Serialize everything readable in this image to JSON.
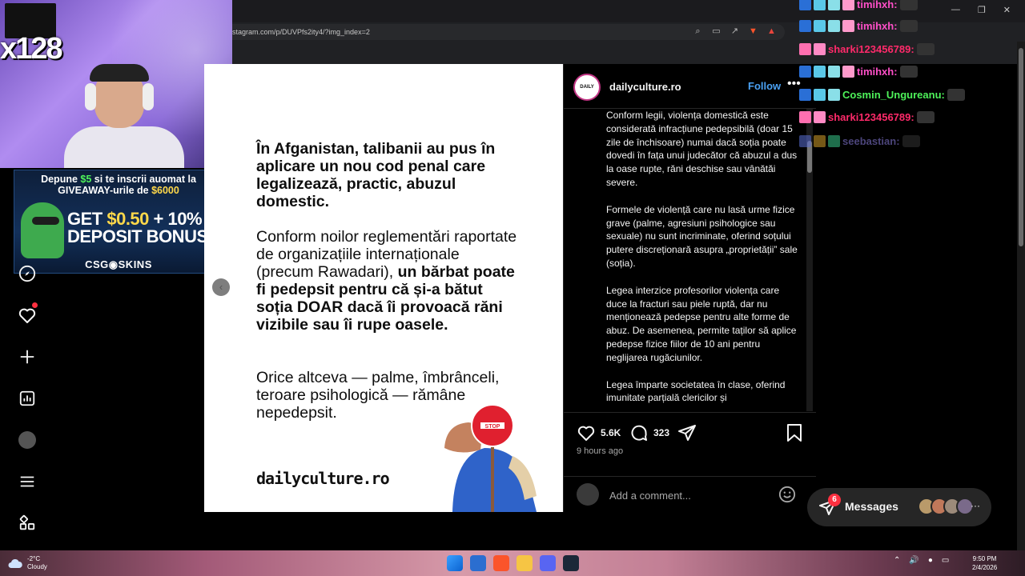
{
  "browser": {
    "url": "stagram.com/p/DUVPfs2ity4/?img_index=2"
  },
  "stream": {
    "sub_count": "x128",
    "ad": {
      "line1_a": "Depune ",
      "line1_amount": "$5",
      "line1_b": " si te inscrii auomat la",
      "line2_a": "GIVEAWAY-urile de ",
      "line2_amount": "$6000",
      "bonus_a": "GET ",
      "bonus_amount": "$0.50",
      "bonus_b": " + 10%",
      "bonus_line2": "DEPOSIT BONUS",
      "brand": "CSG◉SKINS"
    },
    "chat": [
      {
        "user": "timihxh:",
        "color": "#ff4fc8"
      },
      {
        "user": "timihxh:",
        "color": "#ff4fc8"
      },
      {
        "user": "sharki123456789:",
        "color": "#ff2a6a"
      },
      {
        "user": "timihxh:",
        "color": "#ff4fc8"
      },
      {
        "user": "Cosmin_Ungureanu:",
        "color": "#4ef25a"
      },
      {
        "user": "sharki123456789:",
        "color": "#ff2a6a"
      },
      {
        "user": "seebastian:",
        "color": "#8a7ee0"
      }
    ]
  },
  "post": {
    "text1": "În Afganistan, talibanii au pus în aplicare un nou cod penal care legalizează, practic, abuzul domestic.",
    "text2_normal": "Conform noilor reglementări raportate de organizațiile internaționale (precum Rawadari), ",
    "text2_bold": "un bărbat poate fi pedepsit pentru că și-a bătut soția DOAR dacă îi provoacă răni vizibile sau îi rupe oasele.",
    "text3": "Orice altceva — palme, îmbrânceli, teroare psihologică — rămâne nepedepsit.",
    "logo": "dailyculture.ro",
    "stop_sign": "STOP"
  },
  "panel": {
    "avatar_text": "DAILY",
    "username": "dailyculture.ro",
    "follow": "Follow",
    "more": "•••",
    "caption": [
      "Conform legii, violența domestică este considerată infracțiune pedepsibilă (doar 15 zile de închisoare) numai dacă soția poate dovedi în fața unui judecător că abuzul a dus la oase rupte, răni deschise sau vânătăi severe.",
      "Formele de violență care nu lasă urme fizice grave (palme, agresiuni psihologice sau sexuale) nu sunt incriminate, oferind soțului putere discreționară asupra „proprietății” sale (soția).",
      "Legea interzice profesorilor violența care duce la fracturi sau piele ruptă, dar nu menționează pedepse pentru alte forme de abuz. De asemenea, permite taților să aplice pedepse fizice fiilor de 10 ani pentru neglijarea rugăciunilor.",
      "Legea împarte societatea în clase, oferind imunitate parțială clericilor și"
    ],
    "likes": "5.6K",
    "comments": "323",
    "time_ago": "9 hours ago",
    "comment_placeholder": "Add a comment..."
  },
  "messages": {
    "badge": "6",
    "label": "Messages",
    "more": "···"
  },
  "taskbar": {
    "temp": "-2°C",
    "weather": "Cloudy",
    "time": "9:50 PM",
    "date": "2/4/2026"
  },
  "colors": {
    "ig_blue": "#4aa1f3",
    "notification_red": "#ff3040"
  }
}
